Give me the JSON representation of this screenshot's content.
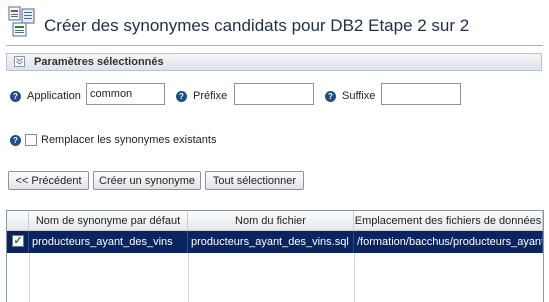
{
  "header": {
    "title": "Créer des synonymes candidats pour DB2 Etape 2 sur 2"
  },
  "section": {
    "label": "Paramètres sélectionnés"
  },
  "form": {
    "application_label": "Application",
    "application_value": "common",
    "prefix_label": "Préfixe",
    "prefix_value": "",
    "suffix_label": "Suffixe",
    "suffix_value": "",
    "replace_label": "Remplacer les synonymes existants",
    "replace_checked": false,
    "help_glyph": "?"
  },
  "buttons": {
    "previous": "<< Précédent",
    "create_synonym": "Créer un synonyme",
    "select_all": "Tout sélectionner"
  },
  "table": {
    "columns": [
      "Nom de synonyme par défaut",
      "Nom du fichier",
      "Emplacement des fichiers de données"
    ],
    "rows": [
      {
        "selected": true,
        "checked_glyph": "✓",
        "synonym": "producteurs_ayant_des_vins",
        "file": "producteurs_ayant_des_vins.sql",
        "location": "/formation/bacchus/producteurs_ayant_des_vins"
      }
    ]
  },
  "colors": {
    "selected_row": "#0a2460",
    "help_icon": "#1d4f86",
    "title_text": "#1f2f45"
  }
}
